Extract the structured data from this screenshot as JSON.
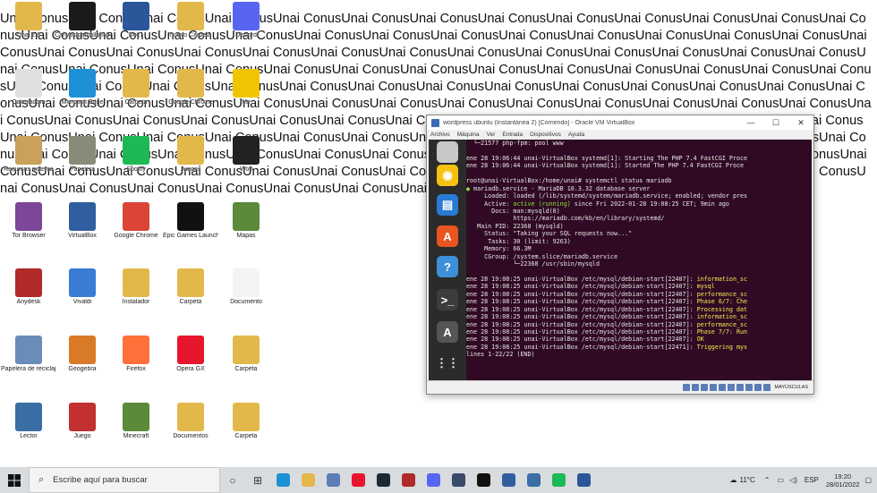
{
  "wallpaper": {
    "text": "Unai ConusUnai ConusUnai ConusUnai ConusUnai ConusUnai ConusUnai ConusUnai ConusUnai ConusUnai ConusUnai ConusUnai ConusUnai ConusUnai ConusUnai ConusUnai ConusUnai ConusUnai ConusUnai ConusUnai ConusUnai ConusUnai ConusUnai ConusUnai ConusUnai ConusUnai ConusUnai ConusUnai ConusUnai ConusUnai ConusUnai ConusUnai ConusUnai ConusUnai ConusUnai ConusUnai ConusUnai ConusUnai ConusUnai ConusUnai ConusUnai ConusUnai ConusUnai ConusUnai ConusUnai ConusUnai ConusUnai ConusUnai ConusUnai ConusUnai ConusUnai ConusUnai ConusUnai ConusUnai ConusUnai ConusUnai ConusUnai ConusUnai ConusUnai ConusUnai ConusUnai ConusUnai ConusUnai ConusUnai ConusUnai ConusUnai ConusUnai ConusUnai ConusUnai ConusUnai ConusUnai ConusUnai ConusUnai ConusUnai ConusUnai ConusUnai ConusUnai ConusUnai ConusUnai ConusUnai ConusUnai ConusUnai ConusUnai ConusUnai ConusUnai ConusUnai ConusUnai ConusUnai ConusUnai ConusUnai ConusUnai ConusUnai ConusUnai ConusUnai ConusUnai ConusUnai ConusUnai ConusUnai ConusUnai ConusUnai ConusUnai ConusUnai ConusUnai ConusUnai ConusUnai ConusUnai ConusUnai ConusUnai ConusUnai ConusUnai ConusUnai ConusUnai ConusUnai ConusUnai ConusUnai ConusUnai ConusUnai ConusUnai ConusUnai ConusUnai ConusUnai ConusUnai ConusUnai ConusUnai ConusUnai ConusUnai ConusUnai ConusUnai ConusUnai ConusUnai ConusUnai ConusUnai ConusUnai ConusUnai ConusUnai Conus"
  },
  "desktop": {
    "icons": [
      {
        "label": "Unai 2.8",
        "color": "#e3b84b"
      },
      {
        "label": "Canvas pantalla IMF",
        "color": "#1a1a1a"
      },
      {
        "label": "Doc1",
        "color": "#2b579a"
      },
      {
        "label": "nuevo Carpeta",
        "color": "#e3b84b"
      },
      {
        "label": "Discord",
        "color": "#5865f2"
      },
      {
        "label": "Calculadora",
        "color": "#e0e0e0"
      },
      {
        "label": "Microsoft Edge",
        "color": "#1e90d6"
      },
      {
        "label": "Carpeta",
        "color": "#e3b84b"
      },
      {
        "label": "Google Chrome",
        "color": "#e3b84b"
      },
      {
        "label": "Mir",
        "color": "#f0c400"
      },
      {
        "label": "Recursos sistema",
        "color": "#c9a15a"
      },
      {
        "label": "Papelera",
        "color": "#8a8a7a"
      },
      {
        "label": "Spotify",
        "color": "#1db954"
      },
      {
        "label": "Juegos",
        "color": "#e3b84b"
      },
      {
        "label": "Wolf",
        "color": "#222222"
      },
      {
        "label": "Tor Browser",
        "color": "#7d4698"
      },
      {
        "label": "VirtualBox",
        "color": "#2f5f9e"
      },
      {
        "label": "Google Chrome",
        "color": "#db4437"
      },
      {
        "label": "Epic Games Launcher",
        "color": "#111111"
      },
      {
        "label": "Mapas",
        "color": "#5a8a3a"
      },
      {
        "label": "Anydesk",
        "color": "#b02a2a"
      },
      {
        "label": "Vivaldi",
        "color": "#3a7bd5"
      },
      {
        "label": "Instalador",
        "color": "#e3b84b"
      },
      {
        "label": "Carpeta",
        "color": "#e3b84b"
      },
      {
        "label": "Documento",
        "color": "#f4f4f4"
      },
      {
        "label": "Papelera de reciclaje",
        "color": "#6a8cb8"
      },
      {
        "label": "Geogebra",
        "color": "#d97a28"
      },
      {
        "label": "Firefox",
        "color": "#ff7139"
      },
      {
        "label": "Opera GX",
        "color": "#e8162c"
      },
      {
        "label": "Carpeta",
        "color": "#e3b84b"
      },
      {
        "label": "Lector",
        "color": "#3a6ea5"
      },
      {
        "label": "Juego",
        "color": "#c23030"
      },
      {
        "label": "Minecraft",
        "color": "#5a8a3a"
      },
      {
        "label": "Documentos",
        "color": "#e3b84b"
      },
      {
        "label": "Carpeta",
        "color": "#e3b84b"
      }
    ]
  },
  "vm": {
    "title": "wordpress ubuntu (Instantánea 2) [Corriendo] - Oracle VM VirtualBox",
    "menu": [
      "Archivo",
      "Máquina",
      "Ver",
      "Entrada",
      "Dispositivos",
      "Ayuda"
    ],
    "status_text": "MAYÚSCULAS",
    "dock": [
      {
        "name": "files-icon",
        "color": "#c8c8c8",
        "glyph": ""
      },
      {
        "name": "rhythmbox-icon",
        "color": "#f5c211",
        "glyph": "◉"
      },
      {
        "name": "writer-icon",
        "color": "#2a7ad5",
        "glyph": "▤"
      },
      {
        "name": "software-icon",
        "color": "#e95420",
        "glyph": "A"
      },
      {
        "name": "help-icon",
        "color": "#3d8fd9",
        "glyph": "?"
      },
      {
        "name": "terminal-icon",
        "color": "#3c3c3c",
        "glyph": ">_"
      },
      {
        "name": "updater-icon",
        "color": "#555555",
        "glyph": "A"
      },
      {
        "name": "show-apps-icon",
        "color": "#2b2b2b",
        "glyph": "⋮⋮"
      }
    ],
    "terminal": [
      {
        "text": "  └─21577 php-fpm: pool www",
        "cls": "hl"
      },
      {
        "text": "",
        "cls": "hl"
      },
      {
        "text": "ene 28 19:06:44 unai-VirtualBox systemd[1]: Starting The PHP 7.4 FastCGI Proce",
        "cls": "hl"
      },
      {
        "text": "ene 28 19:06:44 unai-VirtualBox systemd[1]: Started The PHP 7.4 FastCGI Proce",
        "cls": "hl"
      },
      {
        "text": "",
        "cls": "hl"
      },
      {
        "text": "root@unai-VirtualBox:/home/unai# systemctl status mariadb",
        "cls": "hl"
      },
      {
        "text": "● mariadb.service - MariaDB 10.3.32 database server",
        "cls": "hl"
      },
      {
        "text": "     Loaded: loaded (/lib/systemd/system/mariadb.service; enabled; vendor pres",
        "cls": "hl"
      },
      {
        "text": "     Active: active (running) since Fri 2022-01-28 19:08:25 CET; 9min ago",
        "cls": "hl"
      },
      {
        "text": "       Docs: man:mysqld(8)",
        "cls": "hl"
      },
      {
        "text": "             https://mariadb.com/kb/en/library/systemd/",
        "cls": "hl"
      },
      {
        "text": "   Main PID: 22368 (mysqld)",
        "cls": "hl"
      },
      {
        "text": "     Status: \"Taking your SQL requests now...\"",
        "cls": "hl"
      },
      {
        "text": "      Tasks: 30 (limit: 9263)",
        "cls": "hl"
      },
      {
        "text": "     Memory: 66.3M",
        "cls": "hl"
      },
      {
        "text": "     CGroup: /system.slice/mariadb.service",
        "cls": "hl"
      },
      {
        "text": "             └─22368 /usr/sbin/mysqld",
        "cls": "hl"
      },
      {
        "text": "",
        "cls": "hl"
      },
      {
        "text": "ene 28 19:08:25 unai-VirtualBox /etc/mysql/debian-start[22407]: information_sc",
        "cls": "hl"
      },
      {
        "text": "ene 28 19:08:25 unai-VirtualBox /etc/mysql/debian-start[22407]: mysql",
        "cls": "hl"
      },
      {
        "text": "ene 28 19:08:25 unai-VirtualBox /etc/mysql/debian-start[22407]: performance_sc",
        "cls": "hl"
      },
      {
        "text": "ene 28 19:08:25 unai-VirtualBox /etc/mysql/debian-start[22407]: Phase 6/7: Che",
        "cls": "hl"
      },
      {
        "text": "ene 28 19:08:25 unai-VirtualBox /etc/mysql/debian-start[22407]: Processing dat",
        "cls": "hl"
      },
      {
        "text": "ene 28 19:08:25 unai-VirtualBox /etc/mysql/debian-start[22407]: information_sc",
        "cls": "hl"
      },
      {
        "text": "ene 28 19:08:25 unai-VirtualBox /etc/mysql/debian-start[22407]: performance_sc",
        "cls": "hl"
      },
      {
        "text": "ene 28 19:08:25 unai-VirtualBox /etc/mysql/debian-start[22407]: Phase 7/7: Run",
        "cls": "hl"
      },
      {
        "text": "ene 28 19:08:25 unai-VirtualBox /etc/mysql/debian-start[22407]: OK",
        "cls": "hl"
      },
      {
        "text": "ene 28 19:08:25 unai-VirtualBox /etc/mysql/debian-start[22471]: Triggering mys",
        "cls": "hl"
      },
      {
        "text": "lines 1-22/22 (END)",
        "cls": "hl"
      }
    ]
  },
  "taskbar": {
    "search_placeholder": "Escribe aquí para buscar",
    "apps": [
      {
        "name": "task-view-icon",
        "color": "#333333",
        "glyph": "○"
      },
      {
        "name": "widgets-icon",
        "color": "#333333",
        "glyph": "⊞"
      },
      {
        "name": "edge-taskbar-icon",
        "color": "#1e90d6",
        "glyph": ""
      },
      {
        "name": "explorer-taskbar-icon",
        "color": "#e3b84b",
        "glyph": ""
      },
      {
        "name": "store-taskbar-icon",
        "color": "#5b7db8",
        "glyph": ""
      },
      {
        "name": "opera-taskbar-icon",
        "color": "#e8162c",
        "glyph": ""
      },
      {
        "name": "steam-taskbar-icon",
        "color": "#1b2838",
        "glyph": ""
      },
      {
        "name": "game-taskbar-icon",
        "color": "#b02a2a",
        "glyph": ""
      },
      {
        "name": "discord-taskbar-icon",
        "color": "#5865f2",
        "glyph": ""
      },
      {
        "name": "app-taskbar-icon",
        "color": "#3a4a6a",
        "glyph": ""
      },
      {
        "name": "epic-taskbar-icon",
        "color": "#111111",
        "glyph": ""
      },
      {
        "name": "virtualbox-taskbar-icon",
        "color": "#2f5f9e",
        "glyph": ""
      },
      {
        "name": "remote-taskbar-icon",
        "color": "#3a6ea5",
        "glyph": ""
      },
      {
        "name": "spotify-taskbar-icon",
        "color": "#1db954",
        "glyph": ""
      },
      {
        "name": "word-taskbar-icon",
        "color": "#2b579a",
        "glyph": ""
      }
    ],
    "weather": "11°C",
    "language": "ESP",
    "time": "19:20",
    "date": "28/01/2022"
  }
}
